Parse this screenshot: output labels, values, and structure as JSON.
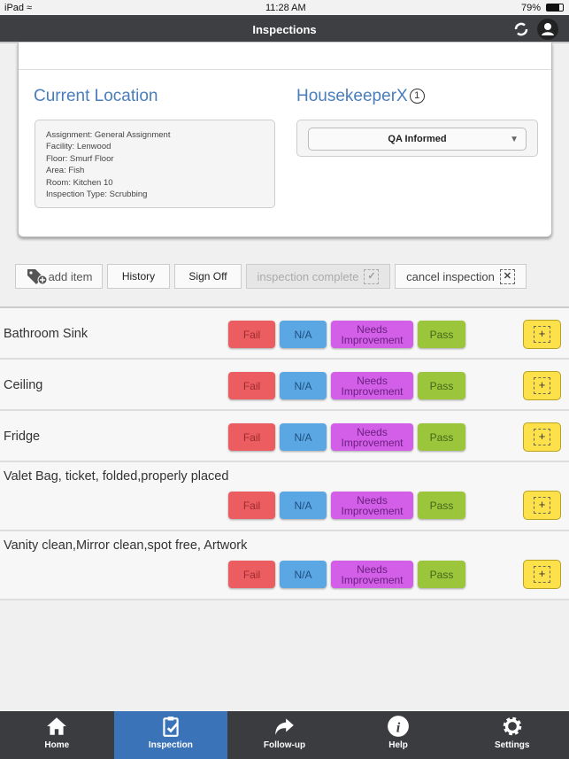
{
  "status": {
    "device": "iPad",
    "time": "11:28 AM",
    "battery": "79%"
  },
  "header": {
    "title": "Inspections"
  },
  "location": {
    "title": "Current Location",
    "lines": [
      "Assignment: General Assignment",
      "Facility: Lenwood",
      "Floor: Smurf Floor",
      "Area: Fish",
      "Room: Kitchen 10",
      "Inspection Type: Scrubbing"
    ]
  },
  "housekeeper": {
    "name": "HousekeeperX",
    "count": "1",
    "select_value": "QA Informed"
  },
  "actions": {
    "add_item": "add item",
    "history": "History",
    "sign_off": "Sign Off",
    "complete": "inspection complete",
    "cancel": "cancel inspection"
  },
  "buttons": {
    "fail": "Fail",
    "na": "N/A",
    "needs": "Needs Improvement",
    "pass": "Pass"
  },
  "items": [
    "Bathroom Sink",
    "Ceiling",
    "Fridge",
    "Valet Bag, ticket, folded,properly placed",
    "Vanity clean,Mirror clean,spot free, Artwork"
  ],
  "tabs": [
    {
      "label": "Home",
      "icon": "home-icon"
    },
    {
      "label": "Inspection",
      "icon": "clipboard-check-icon",
      "active": true
    },
    {
      "label": "Follow-up",
      "icon": "share-arrow-icon"
    },
    {
      "label": "Help",
      "icon": "info-icon"
    },
    {
      "label": "Settings",
      "icon": "gear-icon"
    }
  ],
  "colors": {
    "fail": "#ec5d62",
    "na": "#5aa7e4",
    "needs": "#d35ee8",
    "pass": "#9bc63b",
    "add": "#fde14a",
    "active_tab": "#3a73b8",
    "heading": "#4a7dbb"
  }
}
